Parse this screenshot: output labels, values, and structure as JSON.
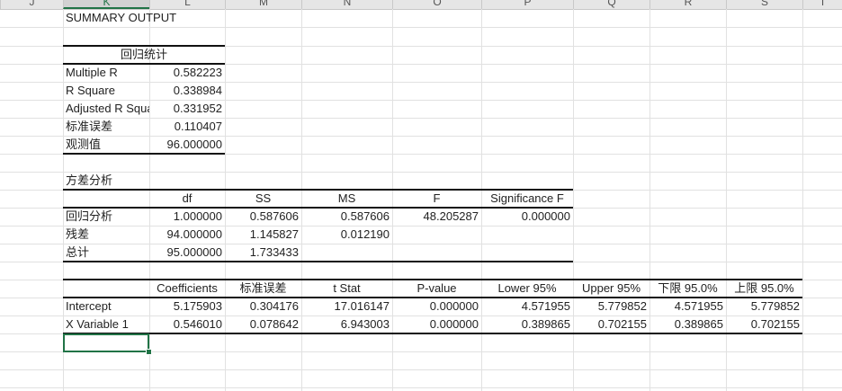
{
  "column_headers": [
    "J",
    "K",
    "L",
    "M",
    "N",
    "O",
    "P",
    "Q",
    "R",
    "S",
    "T"
  ],
  "selected_column": "K",
  "title": "SUMMARY OUTPUT",
  "regression_stats": {
    "header": "回归统计",
    "rows": [
      {
        "label": "Multiple R",
        "value": "0.582223"
      },
      {
        "label": "R Square",
        "value": "0.338984"
      },
      {
        "label": "Adjusted R Square",
        "value": "0.331952"
      },
      {
        "label": "标准误差",
        "value": "0.110407"
      },
      {
        "label": "观测值",
        "value": "96.000000"
      }
    ]
  },
  "anova": {
    "title": "方差分析",
    "headers": [
      "",
      "df",
      "SS",
      "MS",
      "F",
      "Significance F"
    ],
    "rows": [
      [
        "回归分析",
        "1.000000",
        "0.587606",
        "0.587606",
        "48.205287",
        "0.000000"
      ],
      [
        "残差",
        "94.000000",
        "1.145827",
        "0.012190",
        "",
        ""
      ],
      [
        "总计",
        "95.000000",
        "1.733433",
        "",
        "",
        ""
      ]
    ]
  },
  "coefficients": {
    "headers": [
      "",
      "Coefficients",
      "标准误差",
      "t Stat",
      "P-value",
      "Lower 95%",
      "Upper 95%",
      "下限 95.0%",
      "上限 95.0%"
    ],
    "rows": [
      [
        "Intercept",
        "5.175903",
        "0.304176",
        "17.016147",
        "0.000000",
        "4.571955",
        "5.779852",
        "4.571955",
        "5.779852"
      ],
      [
        "X Variable 1",
        "0.546010",
        "0.078642",
        "6.943003",
        "0.000000",
        "0.389865",
        "0.702155",
        "0.389865",
        "0.702155"
      ]
    ]
  },
  "colors": {
    "accent": "#217346",
    "gridline": "#e1e1e1",
    "rule": "#111111"
  }
}
